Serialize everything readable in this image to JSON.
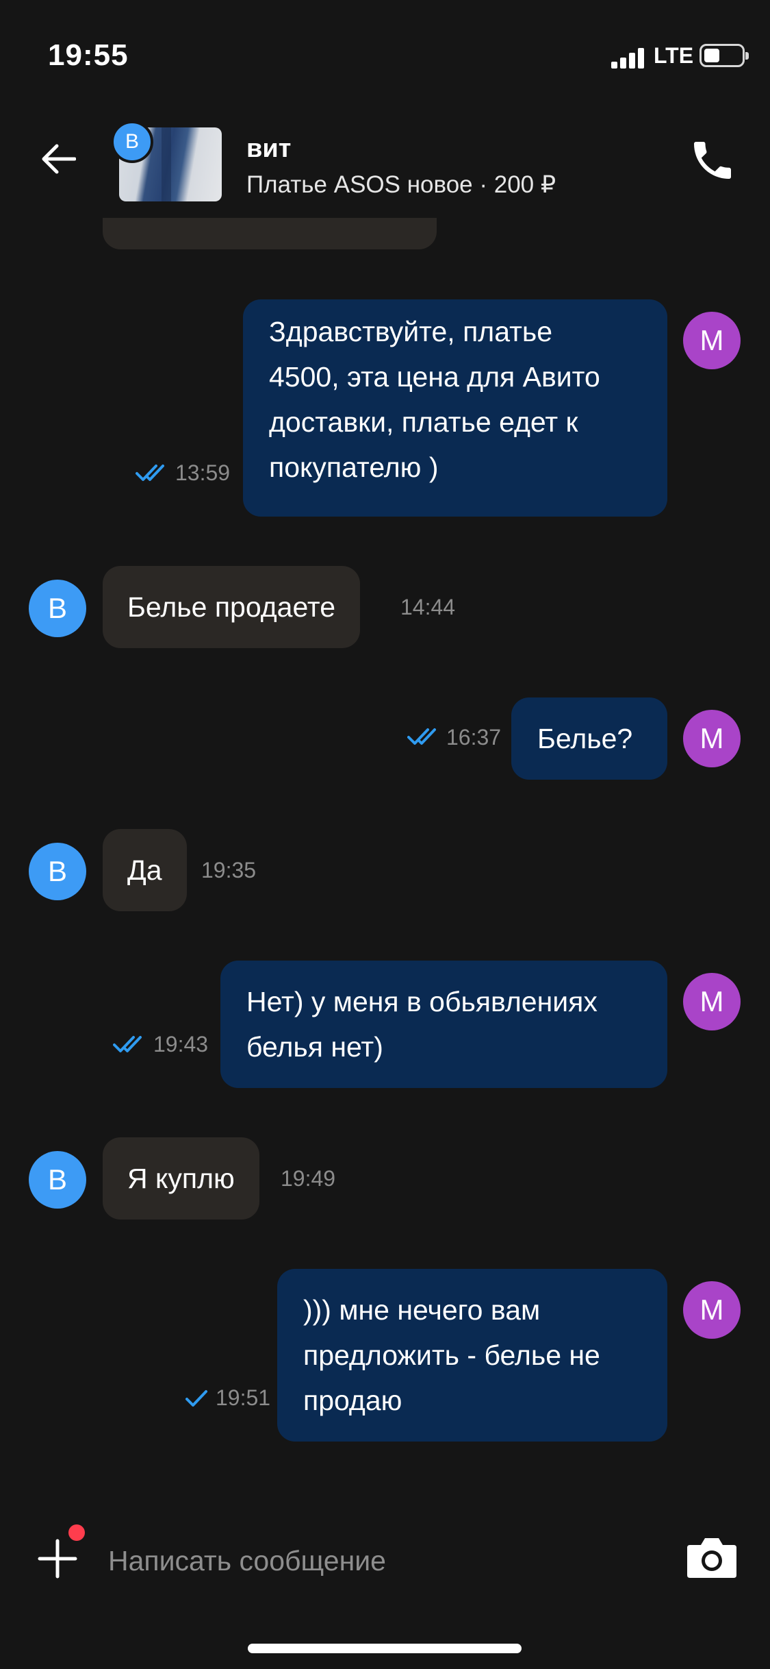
{
  "status_bar": {
    "time": "19:55",
    "network": "LTE",
    "icons": [
      "signal-icon",
      "battery-icon"
    ]
  },
  "header": {
    "contact_name": "вит",
    "contact_initial": "В",
    "listing_title": "Платье ASOS новое · 200 ₽",
    "icons": [
      "back-arrow-icon",
      "phone-icon"
    ]
  },
  "messages": [
    {
      "direction": "in",
      "text": "",
      "time": ""
    },
    {
      "direction": "out",
      "text": "Здравствуйте, платье\n4500, эта цена для Авито\nдоставки, платье едет к\nпокупателю )",
      "time": "13:59",
      "status": "read",
      "avatar": "М"
    },
    {
      "direction": "in",
      "text": "Белье продаете",
      "time": "14:44",
      "avatar": "В"
    },
    {
      "direction": "out",
      "text": "Белье?",
      "time": "16:37",
      "status": "read",
      "avatar": "М"
    },
    {
      "direction": "in",
      "text": "Да",
      "time": "19:35",
      "avatar": "В"
    },
    {
      "direction": "out",
      "text": "Нет) у меня в обьявлениях\nбелья нет)",
      "time": "19:43",
      "status": "read",
      "avatar": "М"
    },
    {
      "direction": "in",
      "text": "Я куплю",
      "time": "19:49",
      "avatar": "В"
    },
    {
      "direction": "out",
      "text": "))) мне нечего вам\nпредложить - белье не\nпродаю",
      "time": "19:51",
      "status": "sent",
      "avatar": "М"
    }
  ],
  "composer": {
    "placeholder": "Написать сообщение",
    "icons": [
      "plus-icon",
      "camera-icon"
    ]
  },
  "colors": {
    "background": "#151515",
    "incoming_bubble": "#2b2825",
    "outgoing_bubble": "#0a2a52",
    "avatar_b": "#3d9bf5",
    "avatar_m": "#a944c8",
    "check_marks": "#2f9bf0",
    "notification_dot": "#ff3d4d"
  }
}
